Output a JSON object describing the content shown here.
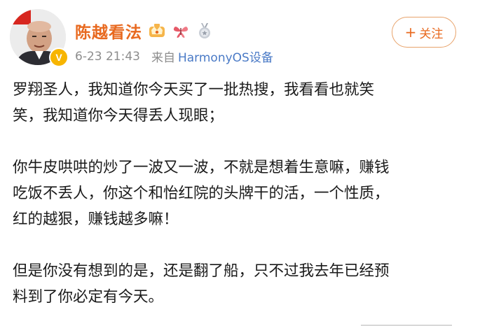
{
  "author": {
    "name": "陈越看法",
    "verified_color": "#f7b500",
    "verified_mark": "V",
    "badges": [
      "crown-badge-icon",
      "butterfly-badge-icon",
      "medal-badge-icon"
    ]
  },
  "meta": {
    "timestamp": "6-23 21:43",
    "source_prefix": "来自",
    "source_device": "HarmonyOS设备"
  },
  "follow_button": {
    "icon": "plus-icon",
    "plus": "+",
    "label": "关注"
  },
  "colors": {
    "accent": "#e8691f",
    "link": "#4a7ac6",
    "meta": "#8d8d8d",
    "text": "#1a1a1a"
  },
  "post": {
    "paragraphs": [
      "罗翔圣人，我知道你今天买了一批热搜，我看看也就笑\n笑，我知道你今天得丢人现眼；",
      "你牛皮哄哄的炒了一波又一波，不就是想着生意嘛，赚钱\n吃饭不丢人，你这个和怡红院的头牌干的活，一个性质，\n红的越狠，赚钱越多嘛！",
      "但是你没有想到的是，还是翻了船，只不过我去年已经预\n料到了你必定有今天。"
    ]
  }
}
